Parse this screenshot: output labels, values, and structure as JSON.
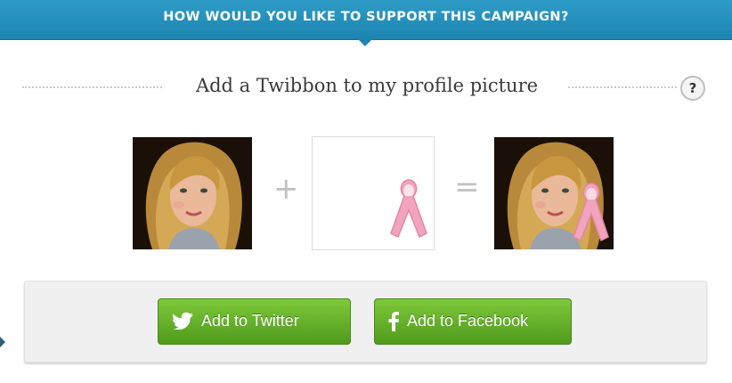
{
  "banner": {
    "title": "HOW WOULD YOU LIKE TO SUPPORT THIS CAMPAIGN?"
  },
  "option": {
    "title": "Add a Twibbon to my profile picture",
    "help_label": "?"
  },
  "composition": {
    "plus_symbol": "+",
    "equals_symbol": "="
  },
  "actions": {
    "twitter_label": "Add to Twitter",
    "facebook_label": "Add to Facebook",
    "twitter_icon": "twitter-bird-icon",
    "facebook_icon": "facebook-f-icon"
  },
  "colors": {
    "banner": "#1d84b0",
    "button_green": "#5fae26",
    "ribbon_pink": "#f2a3bd"
  }
}
